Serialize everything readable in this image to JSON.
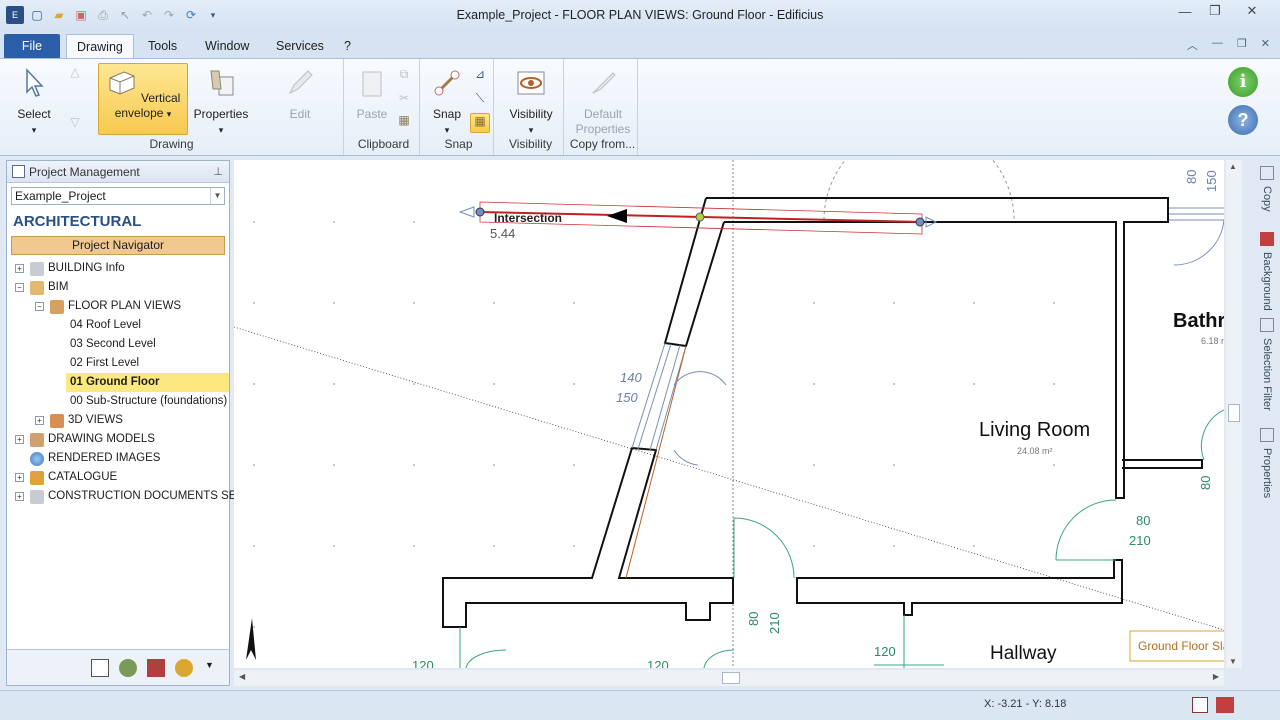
{
  "window": {
    "title": "Example_Project -  FLOOR PLAN VIEWS: Ground Floor - Edificius"
  },
  "tabs": {
    "file": "File",
    "drawing": "Drawing",
    "tools": "Tools",
    "window": "Window",
    "services": "Services",
    "help": "?"
  },
  "ribbon": {
    "select": "Select",
    "vertical_envelope_1": "Vertical",
    "vertical_envelope_2": "envelope",
    "properties": "Properties",
    "edit": "Edit",
    "drawing_group": "Drawing",
    "paste": "Paste",
    "clipboard_group": "Clipboard",
    "snap": "Snap",
    "snap_group": "Snap",
    "visibility": "Visibility",
    "visibility_group": "Visibility",
    "default_properties_1": "Default",
    "default_properties_2": "Properties",
    "copy_from_group": "Copy from..."
  },
  "panel": {
    "title": "Project Management",
    "project": "Example_Project",
    "section": "ARCHITECTURAL",
    "navigator": "Project Navigator",
    "tree": [
      {
        "label": "BUILDING Info"
      },
      {
        "label": "BIM"
      },
      {
        "label": "FLOOR PLAN VIEWS"
      },
      {
        "label": "04 Roof Level"
      },
      {
        "label": "03 Second Level"
      },
      {
        "label": "02 First Level"
      },
      {
        "label": "01 Ground Floor"
      },
      {
        "label": "00 Sub-Structure (foundations)"
      },
      {
        "label": "3D VIEWS"
      },
      {
        "label": "DRAWING MODELS"
      },
      {
        "label": "RENDERED IMAGES"
      },
      {
        "label": "CATALOGUE"
      },
      {
        "label": "CONSTRUCTION DOCUMENTS SET"
      }
    ]
  },
  "canvas": {
    "intersection": "Intersection",
    "length": "5.44",
    "living_room": "Living Room",
    "living_area": "24.08 m²",
    "bathroom": "Bathro",
    "bath_area": "6.18 m²",
    "hallway": "Hallway",
    "dim_140": "140",
    "dim_150": "150",
    "dim_80a": "80",
    "dim_210a": "210",
    "dim_80b": "80",
    "dim_210b": "210",
    "dim_80c": "80",
    "dim_150c": "150",
    "dim_120a": "120",
    "dim_120b": "120",
    "dim_120c": "120",
    "dim_80d": "80",
    "slab": "Ground Floor Sla"
  },
  "rightbar": {
    "copy": "Copy",
    "background": "Background",
    "selection_filter": "Selection Filter",
    "properties": "Properties"
  },
  "status": {
    "coords": "X: -3.21 - Y: 8.18"
  }
}
